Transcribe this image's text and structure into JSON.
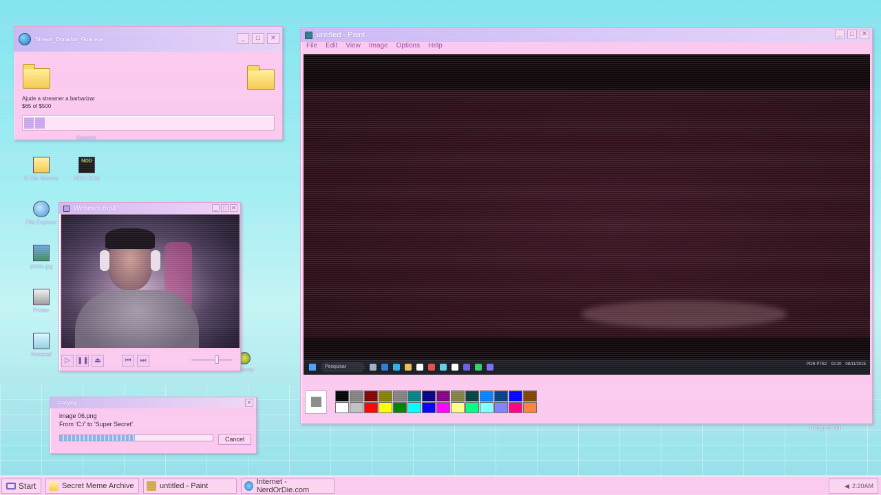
{
  "donation_window": {
    "title": "Stream_Donation_Goal.exe",
    "description": "Ajude a streamer a barbarizar",
    "amount": "$65 of $500",
    "progress": 0.13
  },
  "desktop_icons": [
    {
      "label": "Network"
    },
    {
      "label": "S-Tier Memes"
    },
    {
      "label": "NOD-DOS"
    },
    {
      "label": "File Explorer"
    },
    {
      "label": "photo.jpg"
    },
    {
      "label": "Printer"
    },
    {
      "label": "Notepad"
    },
    {
      "label": "Winamp"
    }
  ],
  "webcam_window": {
    "title": "Webcam.mp4"
  },
  "copy_dialog": {
    "title": "Copying...",
    "file": "image 06.png",
    "route": "From 'C:/' to 'Super Secret'",
    "progress": 0.49,
    "cancel_label": "Cancel"
  },
  "paint_window": {
    "title": "untitled - Paint",
    "menu": [
      "File",
      "Edit",
      "View",
      "Image",
      "Options",
      "Help"
    ],
    "inner_taskbar": {
      "search": "Pesquisar",
      "tray_lang": "POR PTB2",
      "tray_time": "02:20",
      "tray_date": "08/11/2025"
    },
    "palette_colors": [
      "#000000",
      "#808080",
      "#800000",
      "#808000",
      "#808080",
      "#008080",
      "#000080",
      "#800080",
      "#808040",
      "#004040",
      "#0080ff",
      "#004080",
      "#0000ff",
      "#804000",
      "#ffffff",
      "#c0c0c0",
      "#ff0000",
      "#ffff00",
      "#008000",
      "#00ffff",
      "#0000ff",
      "#ff00ff",
      "#ffff80",
      "#00ff80",
      "#80ffff",
      "#8080ff",
      "#ff0080",
      "#ff8040"
    ]
  },
  "desktop": {
    "recycle_bin_label": "Recycle Bin"
  },
  "taskbar": {
    "start_label": "Start",
    "items": [
      {
        "label": "Secret Meme Archive"
      },
      {
        "label": "untitled - Paint"
      },
      {
        "label": "Internet - NerdOrDie.com"
      }
    ],
    "clock": "2:20AM"
  }
}
